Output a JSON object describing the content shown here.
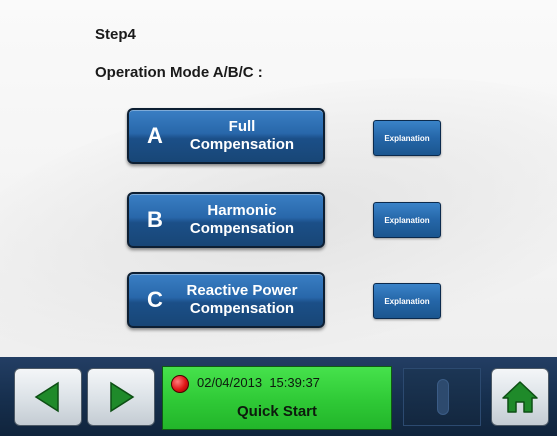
{
  "header": {
    "step": "Step4",
    "mode_title": "Operation Mode A/B/C :"
  },
  "modes": [
    {
      "letter": "A",
      "line1": "Full",
      "line2": "Compensation",
      "explain": "Explanation"
    },
    {
      "letter": "B",
      "line1": "Harmonic",
      "line2": "Compensation",
      "explain": "Explanation"
    },
    {
      "letter": "C",
      "line1": "Reactive Power",
      "line2": "Compensation",
      "explain": "Explanation"
    }
  ],
  "status": {
    "date": "02/04/2013",
    "time": "15:39:37",
    "title": "Quick Start",
    "led_color": "#e01515",
    "panel_color": "#2fc936"
  },
  "icons": {
    "back": "triangle-left-icon",
    "forward": "triangle-right-icon",
    "home": "home-icon"
  },
  "colors": {
    "button_blue": "#2867aa",
    "bar_navy": "#17304f",
    "arrow_green": "#1f8a2a"
  }
}
